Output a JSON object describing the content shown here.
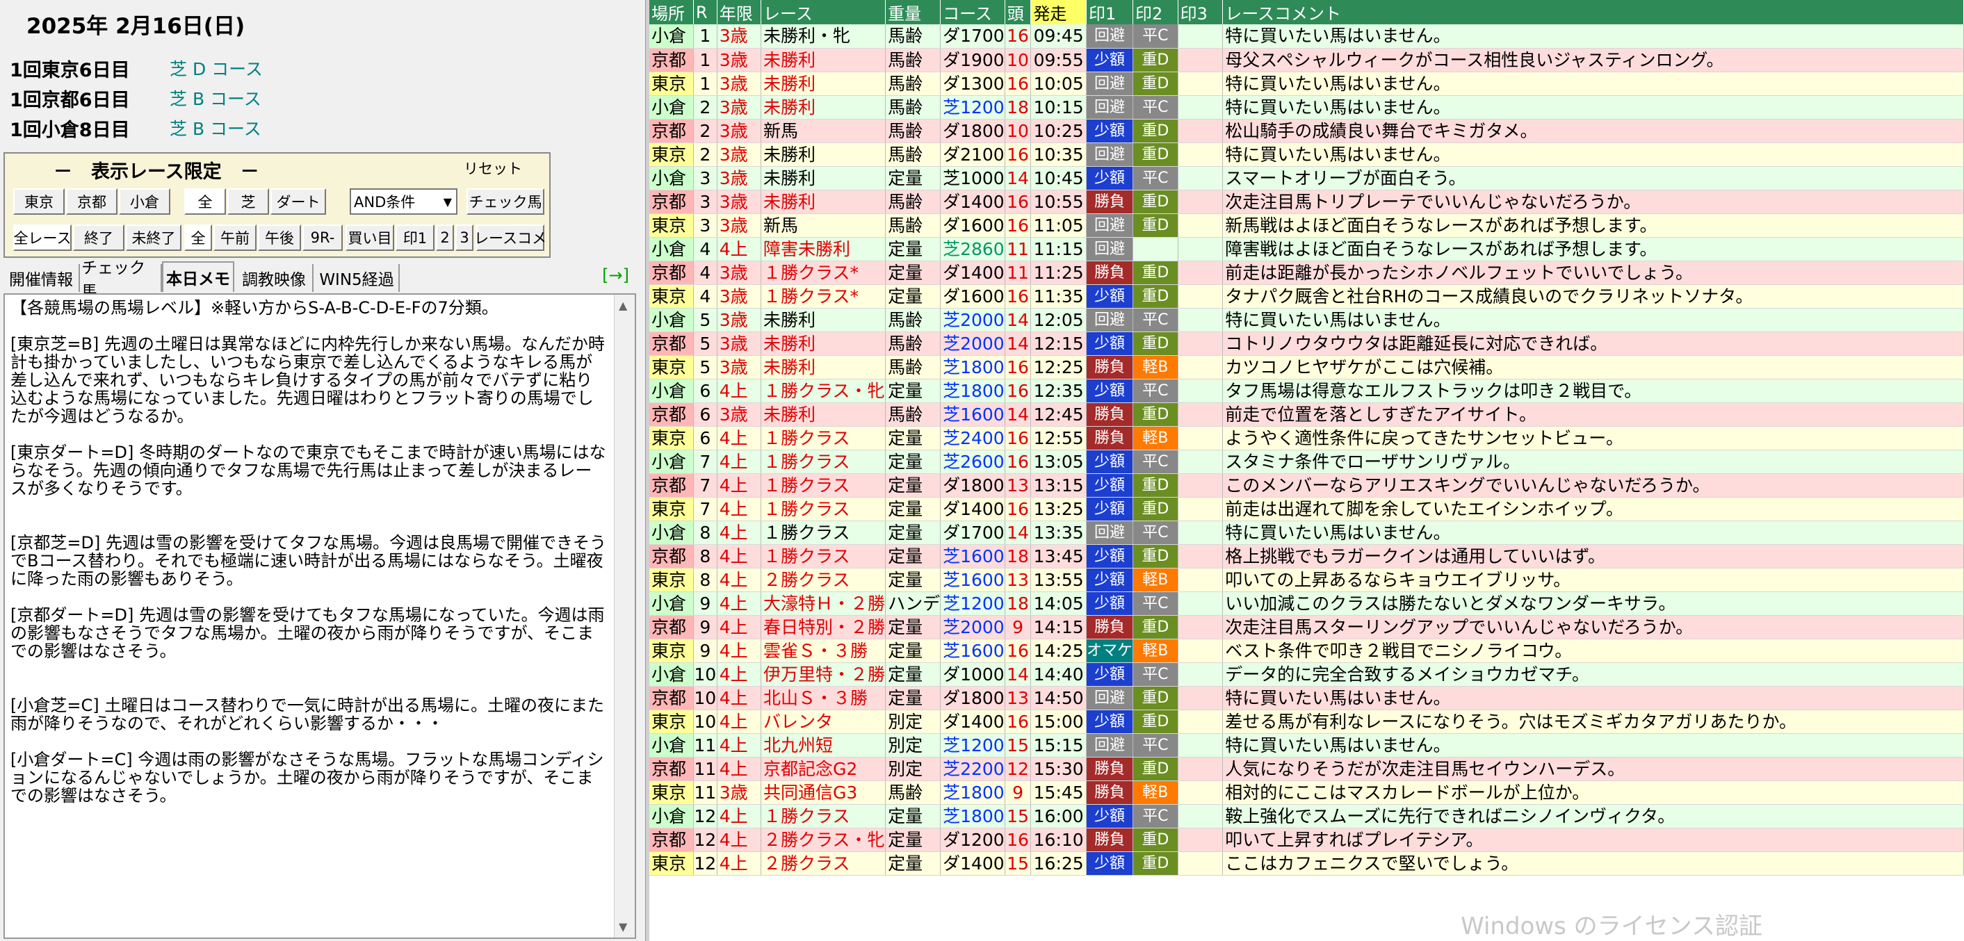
{
  "date": "2025年 2月16日(日)",
  "meetings": [
    {
      "name": "1回東京6日目",
      "course": "芝 D コース"
    },
    {
      "name": "1回京都6日目",
      "course": "芝 B コース"
    },
    {
      "name": "1回小倉8日目",
      "course": "芝 B コース"
    }
  ],
  "filter": {
    "title": "－　表示レース限定　－",
    "reset": "リセット",
    "venues": [
      "東京",
      "京都",
      "小倉"
    ],
    "surface": [
      "全",
      "芝",
      "ダート"
    ],
    "condition": "AND条件",
    "check_horse": "チェック馬",
    "status": [
      "全レース",
      "終了",
      "未終了"
    ],
    "time": [
      "全",
      "午前",
      "午後",
      "9R-"
    ],
    "buy": "買い目",
    "marks": [
      "印1",
      "2",
      "3"
    ],
    "comment": "レースコメ"
  },
  "tabs": [
    "開催情報",
    "チェック馬",
    "本日メモ",
    "調教映像",
    "WIN5経過"
  ],
  "tab_arrow": "[→]",
  "memo": "【各競馬場の馬場レベル】※軽い方からS-A-B-C-D-E-Fの7分類。\n\n[東京芝=B] 先週の土曜日は異常なほどに内枠先行しか来ない馬場。なんだか時計も掛かっていましたし、いつもなら東京で差し込んでくるようなキレる馬が差し込んで来れず、いつもならキレ負けするタイプの馬が前々でバテずに粘り込むような馬場になっていました。先週日曜はわりとフラット寄りの馬場でしたが今週はどうなるか。\n\n[東京ダート=D] 冬時期のダートなので東京でもそこまで時計が速い馬場にはならなそう。先週の傾向通りでタフな馬場で先行馬は止まって差しが決まるレースが多くなりそうです。\n\n\n[京都芝=D] 先週は雪の影響を受けてタフな馬場。今週は良馬場で開催できそうでBコース替わり。それでも極端に速い時計が出る馬場にはならなそう。土曜夜に降った雨の影響もありそう。\n\n[京都ダート=D] 先週は雪の影響を受けてもタフな馬場になっていた。今週は雨の影響もなさそうでタフな馬場か。土曜の夜から雨が降りそうですが、そこまでの影響はなさそう。\n\n\n[小倉芝=C] 土曜日はコース替わりで一気に時計が出る馬場に。土曜の夜にまた雨が降りそうなので、それがどれくらい影響するか・・・\n\n[小倉ダート=C] 今週は雨の影響がなさそうな馬場。フラットな馬場コンディションになるんじゃないでしょうか。土曜の夜から雨が降りそうですが、そこまでの影響はなさそう。",
  "table": {
    "headers": [
      "場所",
      "R",
      "年限",
      "レース",
      "重量",
      "コース",
      "頭",
      "発走",
      "印1",
      "印2",
      "印3",
      "レースコメント"
    ],
    "rows": [
      {
        "venue": "小倉",
        "r": "1",
        "age": "3歳",
        "race": "未勝利・牝",
        "race_c": "dark",
        "wt": "馬齢",
        "course": "ダ1700",
        "course_c": "dark",
        "n": "16",
        "time": "09:45",
        "m1": "回避",
        "m1c": "kaihi",
        "m2": "平C",
        "m2c": "heic",
        "cm": "特に買いたい馬はいません。"
      },
      {
        "venue": "京都",
        "r": "1",
        "age": "3歳",
        "race": "未勝利",
        "race_c": "red",
        "wt": "馬齢",
        "course": "ダ1900",
        "course_c": "dark",
        "n": "10",
        "time": "09:55",
        "m1": "少額",
        "m1c": "shogaku",
        "m2": "重D",
        "m2c": "omod",
        "cm": "母父スペシャルウィークがコース相性良いジャスティンロング。"
      },
      {
        "venue": "東京",
        "r": "1",
        "age": "3歳",
        "race": "未勝利",
        "race_c": "red",
        "wt": "馬齢",
        "course": "ダ1300",
        "course_c": "dark",
        "n": "16",
        "time": "10:05",
        "m1": "回避",
        "m1c": "kaihi",
        "m2": "重D",
        "m2c": "omod",
        "cm": "特に買いたい馬はいません。"
      },
      {
        "venue": "小倉",
        "r": "2",
        "age": "3歳",
        "race": "未勝利",
        "race_c": "red",
        "wt": "馬齢",
        "course": "芝1200",
        "course_c": "blue",
        "n": "18",
        "time": "10:15",
        "m1": "回避",
        "m1c": "kaihi",
        "m2": "平C",
        "m2c": "heic",
        "cm": "特に買いたい馬はいません。"
      },
      {
        "venue": "京都",
        "r": "2",
        "age": "3歳",
        "race": "新馬",
        "race_c": "dark",
        "wt": "馬齢",
        "course": "ダ1800",
        "course_c": "dark",
        "n": "10",
        "time": "10:25",
        "m1": "少額",
        "m1c": "shogaku",
        "m2": "重D",
        "m2c": "omod",
        "cm": "松山騎手の成績良い舞台でキミガタメ。"
      },
      {
        "venue": "東京",
        "r": "2",
        "age": "3歳",
        "race": "未勝利",
        "race_c": "dark",
        "wt": "馬齢",
        "course": "ダ2100",
        "course_c": "dark",
        "n": "16",
        "time": "10:35",
        "m1": "回避",
        "m1c": "kaihi",
        "m2": "重D",
        "m2c": "omod",
        "cm": "特に買いたい馬はいません。"
      },
      {
        "venue": "小倉",
        "r": "3",
        "age": "3歳",
        "race": "未勝利",
        "race_c": "dark",
        "wt": "定量",
        "course": "芝1000",
        "course_c": "dark",
        "n": "14",
        "time": "10:45",
        "m1": "少額",
        "m1c": "shogaku",
        "m2": "平C",
        "m2c": "heic",
        "cm": "スマートオリーブが面白そう。"
      },
      {
        "venue": "京都",
        "r": "3",
        "age": "3歳",
        "race": "未勝利",
        "race_c": "red",
        "wt": "馬齢",
        "course": "ダ1400",
        "course_c": "dark",
        "n": "16",
        "time": "10:55",
        "m1": "勝負",
        "m1c": "shobu",
        "m2": "重D",
        "m2c": "omod",
        "cm": "次走注目馬トリプレーテでいいんじゃないだろうか。"
      },
      {
        "venue": "東京",
        "r": "3",
        "age": "3歳",
        "race": "新馬",
        "race_c": "dark",
        "wt": "馬齢",
        "course": "ダ1600",
        "course_c": "dark",
        "n": "16",
        "time": "11:05",
        "m1": "回避",
        "m1c": "kaihi",
        "m2": "重D",
        "m2c": "omod",
        "cm": "新馬戦はよほど面白そうなレースがあれば予想します。"
      },
      {
        "venue": "小倉",
        "r": "4",
        "age": "4上",
        "race": "障害未勝利",
        "race_c": "red",
        "wt": "定量",
        "course": "芝2860",
        "course_c": "green",
        "n": "11",
        "time": "11:15",
        "m1": "回避",
        "m1c": "kaihi",
        "m2": "",
        "m2c": "",
        "cm": "障害戦はよほど面白そうなレースがあれば予想します。"
      },
      {
        "venue": "京都",
        "r": "4",
        "age": "3歳",
        "race": "１勝クラス*",
        "race_c": "red",
        "wt": "定量",
        "course": "ダ1400",
        "course_c": "dark",
        "n": "11",
        "time": "11:25",
        "m1": "勝負",
        "m1c": "shobu",
        "m2": "重D",
        "m2c": "omod",
        "cm": "前走は距離が長かったシホノベルフェットでいいでしょう。"
      },
      {
        "venue": "東京",
        "r": "4",
        "age": "3歳",
        "race": "１勝クラス*",
        "race_c": "red",
        "wt": "定量",
        "course": "ダ1600",
        "course_c": "dark",
        "n": "16",
        "time": "11:35",
        "m1": "少額",
        "m1c": "shogaku",
        "m2": "重D",
        "m2c": "omod",
        "cm": "タナパク厩舎と社台RHのコース成績良いのでクラリネットソナタ。"
      },
      {
        "venue": "小倉",
        "r": "5",
        "age": "3歳",
        "race": "未勝利",
        "race_c": "dark",
        "wt": "馬齢",
        "course": "芝2000",
        "course_c": "blue",
        "n": "14",
        "time": "12:05",
        "m1": "回避",
        "m1c": "kaihi",
        "m2": "平C",
        "m2c": "heic",
        "cm": "特に買いたい馬はいません。"
      },
      {
        "venue": "京都",
        "r": "5",
        "age": "3歳",
        "race": "未勝利",
        "race_c": "red",
        "wt": "馬齢",
        "course": "芝2000",
        "course_c": "blue",
        "n": "14",
        "time": "12:15",
        "m1": "少額",
        "m1c": "shogaku",
        "m2": "重D",
        "m2c": "omod",
        "cm": "コトリノウタウウタは距離延長に対応できれば。"
      },
      {
        "venue": "東京",
        "r": "5",
        "age": "3歳",
        "race": "未勝利",
        "race_c": "red",
        "wt": "馬齢",
        "course": "芝1800",
        "course_c": "blue",
        "n": "16",
        "time": "12:25",
        "m1": "勝負",
        "m1c": "shobu",
        "m2": "軽B",
        "m2c": "karub",
        "cm": "カツコノヒヤザケがここは穴候補。"
      },
      {
        "venue": "小倉",
        "r": "6",
        "age": "4上",
        "race": "１勝クラス・牝",
        "race_c": "red",
        "wt": "定量",
        "course": "芝1800",
        "course_c": "blue",
        "n": "16",
        "time": "12:35",
        "m1": "少額",
        "m1c": "shogaku",
        "m2": "平C",
        "m2c": "heic",
        "cm": "タフ馬場は得意なエルフストラックは叩き２戦目で。"
      },
      {
        "venue": "京都",
        "r": "6",
        "age": "3歳",
        "race": "未勝利",
        "race_c": "red",
        "wt": "馬齢",
        "course": "芝1600",
        "course_c": "blue",
        "n": "14",
        "time": "12:45",
        "m1": "勝負",
        "m1c": "shobu",
        "m2": "重D",
        "m2c": "omod",
        "cm": "前走で位置を落としすぎたアイサイト。"
      },
      {
        "venue": "東京",
        "r": "6",
        "age": "4上",
        "race": "１勝クラス",
        "race_c": "red",
        "wt": "定量",
        "course": "芝2400",
        "course_c": "blue",
        "n": "16",
        "time": "12:55",
        "m1": "勝負",
        "m1c": "shobu",
        "m2": "軽B",
        "m2c": "karub",
        "cm": "ようやく適性条件に戻ってきたサンセットビュー。"
      },
      {
        "venue": "小倉",
        "r": "7",
        "age": "4上",
        "race": "１勝クラス",
        "race_c": "red",
        "wt": "定量",
        "course": "芝2600",
        "course_c": "blue",
        "n": "16",
        "time": "13:05",
        "m1": "少額",
        "m1c": "shogaku",
        "m2": "平C",
        "m2c": "heic",
        "cm": "スタミナ条件でローザサンリヴァル。"
      },
      {
        "venue": "京都",
        "r": "7",
        "age": "4上",
        "race": "１勝クラス",
        "race_c": "red",
        "wt": "定量",
        "course": "ダ1800",
        "course_c": "dark",
        "n": "13",
        "time": "13:15",
        "m1": "少額",
        "m1c": "shogaku",
        "m2": "重D",
        "m2c": "omod",
        "cm": "このメンバーならアリエスキングでいいんじゃないだろうか。"
      },
      {
        "venue": "東京",
        "r": "7",
        "age": "4上",
        "race": "１勝クラス",
        "race_c": "red",
        "wt": "定量",
        "course": "ダ1400",
        "course_c": "dark",
        "n": "16",
        "time": "13:25",
        "m1": "少額",
        "m1c": "shogaku",
        "m2": "重D",
        "m2c": "omod",
        "cm": "前走は出遅れて脚を余していたエイシンホイップ。"
      },
      {
        "venue": "小倉",
        "r": "8",
        "age": "4上",
        "race": "１勝クラス",
        "race_c": "dark",
        "wt": "定量",
        "course": "ダ1700",
        "course_c": "dark",
        "n": "14",
        "time": "13:35",
        "m1": "回避",
        "m1c": "kaihi",
        "m2": "平C",
        "m2c": "heic",
        "cm": "特に買いたい馬はいません。"
      },
      {
        "venue": "京都",
        "r": "8",
        "age": "4上",
        "race": "１勝クラス",
        "race_c": "red",
        "wt": "定量",
        "course": "芝1600",
        "course_c": "blue",
        "n": "18",
        "time": "13:45",
        "m1": "少額",
        "m1c": "shogaku",
        "m2": "重D",
        "m2c": "omod",
        "cm": "格上挑戦でもラガークインは通用していいはず。"
      },
      {
        "venue": "東京",
        "r": "8",
        "age": "4上",
        "race": "２勝クラス",
        "race_c": "red",
        "wt": "定量",
        "course": "芝1600",
        "course_c": "blue",
        "n": "13",
        "time": "13:55",
        "m1": "少額",
        "m1c": "shogaku",
        "m2": "軽B",
        "m2c": "karub",
        "cm": "叩いての上昇あるならキョウエイブリッサ。"
      },
      {
        "venue": "小倉",
        "r": "9",
        "age": "4上",
        "race": "大濠特Ｈ・２勝",
        "race_c": "red",
        "wt": "ハンデ",
        "course": "芝1200",
        "course_c": "blue",
        "n": "18",
        "time": "14:05",
        "m1": "少額",
        "m1c": "shogaku",
        "m2": "平C",
        "m2c": "heic",
        "cm": "いい加減このクラスは勝たないとダメなワンダーキサラ。"
      },
      {
        "venue": "京都",
        "r": "9",
        "age": "4上",
        "race": "春日特別・２勝",
        "race_c": "red",
        "wt": "定量",
        "course": "芝2000",
        "course_c": "blue",
        "n": "9",
        "time": "14:15",
        "m1": "勝負",
        "m1c": "shobu",
        "m2": "重D",
        "m2c": "omod",
        "cm": "次走注目馬スターリングアップでいいんじゃないだろうか。"
      },
      {
        "venue": "東京",
        "r": "9",
        "age": "4上",
        "race": "雲雀Ｓ・３勝",
        "race_c": "red",
        "wt": "定量",
        "course": "芝1600",
        "course_c": "blue",
        "n": "16",
        "time": "14:25",
        "m1": "オマケ",
        "m1c": "omake",
        "m2": "軽B",
        "m2c": "karub",
        "cm": "ベスト条件で叩き２戦目でニシノライコウ。"
      },
      {
        "venue": "小倉",
        "r": "10",
        "age": "4上",
        "race": "伊万里特・２勝",
        "race_c": "red",
        "wt": "定量",
        "course": "ダ1000",
        "course_c": "dark",
        "n": "14",
        "time": "14:40",
        "m1": "少額",
        "m1c": "shogaku",
        "m2": "平C",
        "m2c": "heic",
        "cm": "データ的に完全合致するメイショウカゼマチ。"
      },
      {
        "venue": "京都",
        "r": "10",
        "age": "4上",
        "race": "北山Ｓ・３勝",
        "race_c": "red",
        "wt": "定量",
        "course": "ダ1800",
        "course_c": "dark",
        "n": "13",
        "time": "14:50",
        "m1": "回避",
        "m1c": "kaihi",
        "m2": "重D",
        "m2c": "omod",
        "cm": "特に買いたい馬はいません。"
      },
      {
        "venue": "東京",
        "r": "10",
        "age": "4上",
        "race": "バレンタ",
        "race_c": "red",
        "wt": "別定",
        "course": "ダ1400",
        "course_c": "dark",
        "n": "16",
        "time": "15:00",
        "m1": "少額",
        "m1c": "shogaku",
        "m2": "重D",
        "m2c": "omod",
        "cm": "差せる馬が有利なレースになりそう。穴はモズミギカタアガリあたりか。"
      },
      {
        "venue": "小倉",
        "r": "11",
        "age": "4上",
        "race": "北九州短",
        "race_c": "red",
        "wt": "別定",
        "course": "芝1200",
        "course_c": "blue",
        "n": "15",
        "time": "15:15",
        "m1": "回避",
        "m1c": "kaihi",
        "m2": "平C",
        "m2c": "heic",
        "cm": "特に買いたい馬はいません。"
      },
      {
        "venue": "京都",
        "r": "11",
        "age": "4上",
        "race": "京都記念G2",
        "race_c": "red",
        "wt": "別定",
        "course": "芝2200",
        "course_c": "blue",
        "n": "12",
        "time": "15:30",
        "m1": "勝負",
        "m1c": "shobu",
        "m2": "重D",
        "m2c": "omod",
        "cm": "人気になりそうだが次走注目馬セイウンハーデス。"
      },
      {
        "venue": "東京",
        "r": "11",
        "age": "3歳",
        "race": "共同通信G3",
        "race_c": "red",
        "wt": "馬齢",
        "course": "芝1800",
        "course_c": "blue",
        "n": "9",
        "time": "15:45",
        "m1": "勝負",
        "m1c": "shobu",
        "m2": "軽B",
        "m2c": "karub",
        "cm": "相対的にここはマスカレードボールが上位か。"
      },
      {
        "venue": "小倉",
        "r": "12",
        "age": "4上",
        "race": "１勝クラス",
        "race_c": "red",
        "wt": "定量",
        "course": "芝1800",
        "course_c": "blue",
        "n": "15",
        "time": "16:00",
        "m1": "少額",
        "m1c": "shogaku",
        "m2": "平C",
        "m2c": "heic",
        "cm": "鞍上強化でスムーズに先行できればニシノインヴィクタ。"
      },
      {
        "venue": "京都",
        "r": "12",
        "age": "4上",
        "race": "２勝クラス・牝",
        "race_c": "red",
        "wt": "定量",
        "course": "ダ1200",
        "course_c": "dark",
        "n": "16",
        "time": "16:10",
        "m1": "勝負",
        "m1c": "shobu",
        "m2": "重D",
        "m2c": "omod",
        "cm": "叩いて上昇すればプレイテシア。"
      },
      {
        "venue": "東京",
        "r": "12",
        "age": "4上",
        "race": "２勝クラス",
        "race_c": "red",
        "wt": "定量",
        "course": "ダ1400",
        "course_c": "dark",
        "n": "15",
        "time": "16:25",
        "m1": "少額",
        "m1c": "shogaku",
        "m2": "重D",
        "m2c": "omod",
        "cm": "ここはカフェニクスで堅いでしょう。"
      }
    ]
  },
  "watermark": "Windows のライセンス認証"
}
